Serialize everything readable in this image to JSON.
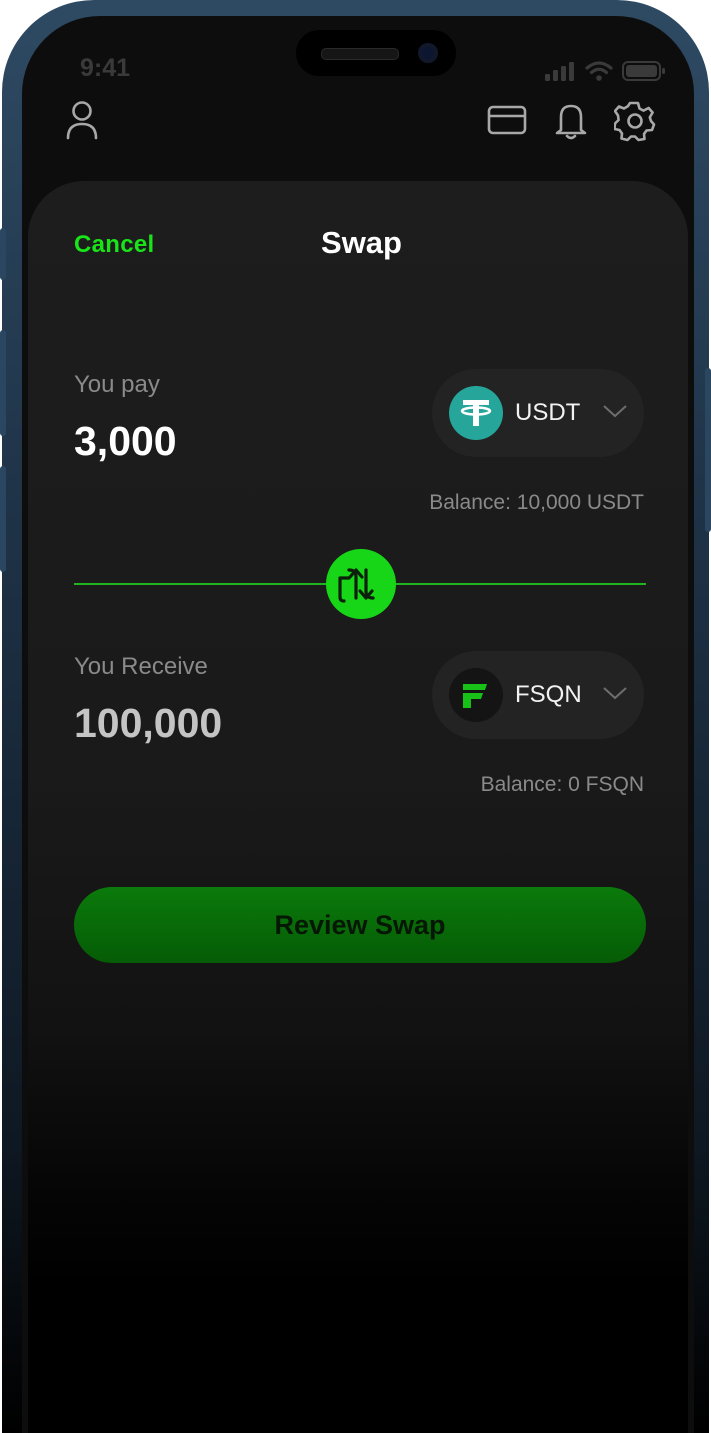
{
  "status_bar": {
    "time": "9:41"
  },
  "header_icons": [
    "person-icon",
    "card-icon",
    "bell-icon",
    "gear-icon"
  ],
  "swap": {
    "cancel_label": "Cancel",
    "title": "Swap",
    "pay": {
      "label": "You pay",
      "amount": "3,000",
      "token_symbol": "USDT",
      "balance": "Balance: 10,000 USDT"
    },
    "receive": {
      "label": "You Receive",
      "amount": "100,000",
      "token_symbol": "FSQN",
      "balance": "Balance: 0 FSQN"
    },
    "review_label": "Review Swap"
  },
  "colors": {
    "accent": "#18e418",
    "button_green": "#0b7a0b",
    "usdt_teal": "#26a69a",
    "background": "#1a1a1a"
  }
}
